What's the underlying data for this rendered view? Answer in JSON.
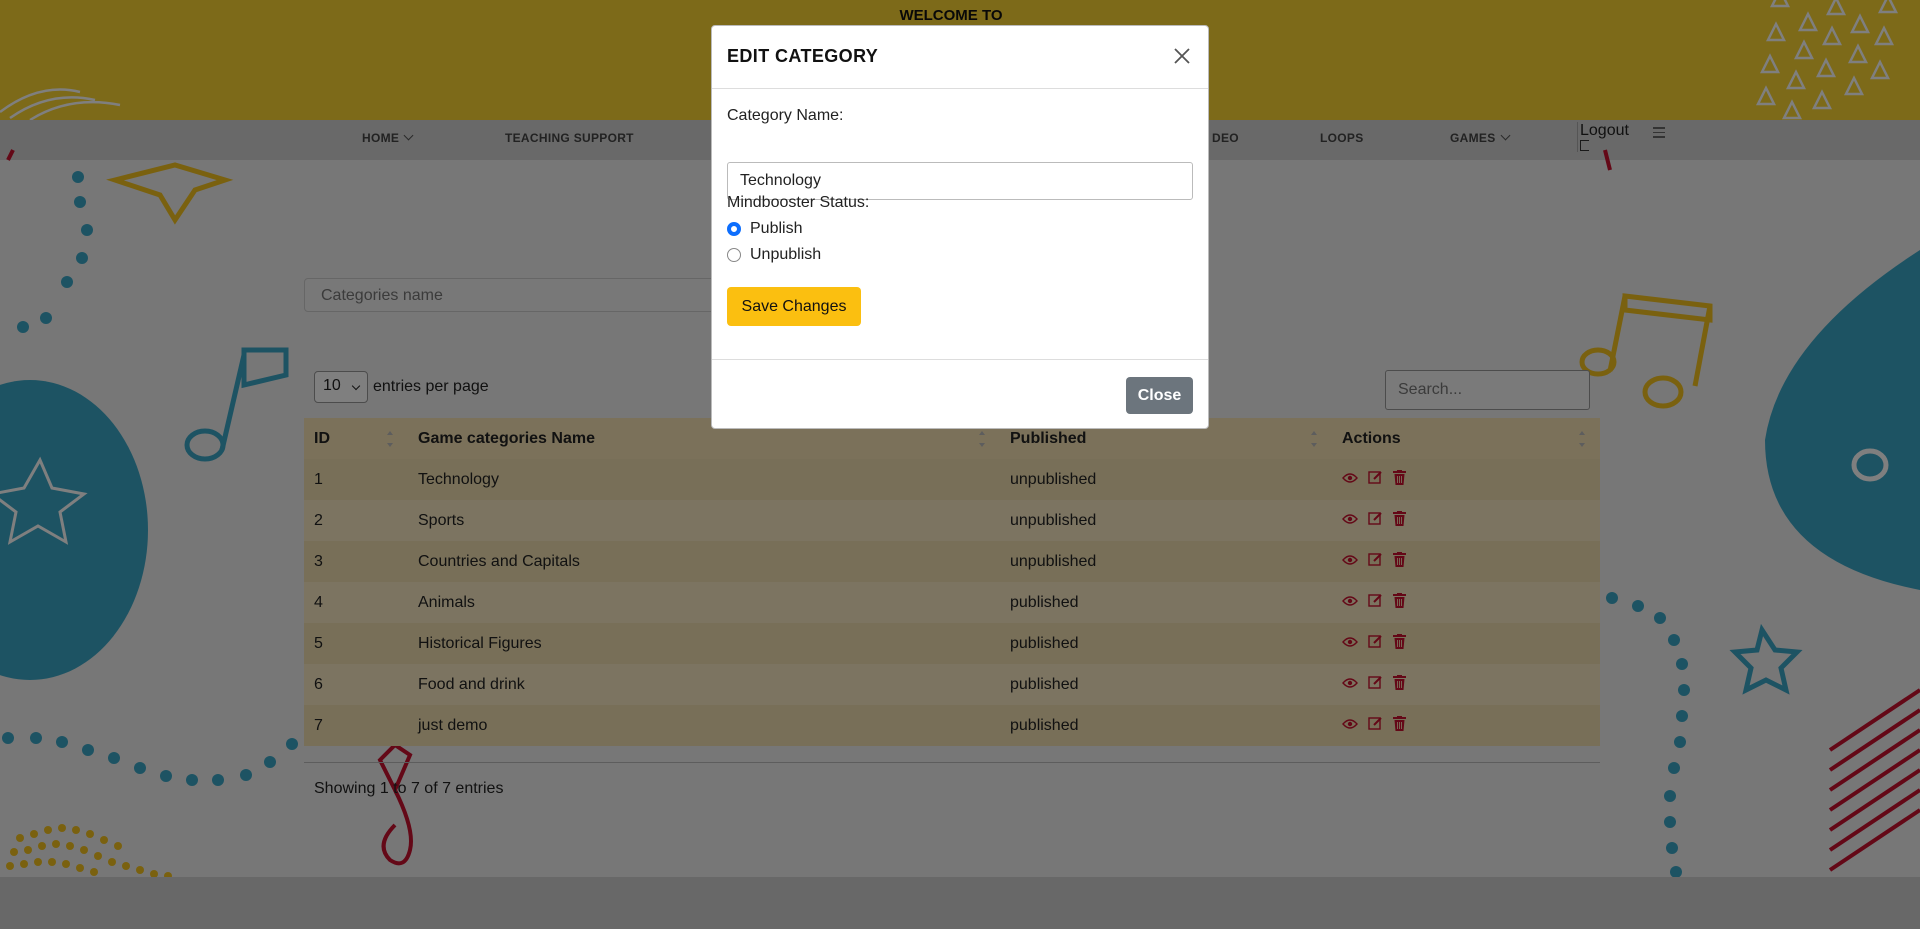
{
  "header": {
    "welcome": "WELCOME TO"
  },
  "nav": {
    "items": [
      {
        "label": "HOME",
        "dropdown": true
      },
      {
        "label": "TEACHING SUPPORT",
        "dropdown": false
      },
      {
        "label": "DEO",
        "dropdown": false
      },
      {
        "label": "LOOPS",
        "dropdown": false
      },
      {
        "label": "GAMES",
        "dropdown": true
      }
    ],
    "logout": "Logout"
  },
  "filter": {
    "placeholder": "Categories name"
  },
  "table_controls": {
    "entries_value": "10",
    "entries_label": "entries per page",
    "search_placeholder": "Search..."
  },
  "table": {
    "columns": [
      "ID",
      "Game categories Name",
      "Published",
      "Actions"
    ],
    "rows": [
      {
        "id": "1",
        "name": "Technology",
        "published": "unpublished"
      },
      {
        "id": "2",
        "name": "Sports",
        "published": "unpublished"
      },
      {
        "id": "3",
        "name": "Countries and Capitals",
        "published": "unpublished"
      },
      {
        "id": "4",
        "name": "Animals",
        "published": "published"
      },
      {
        "id": "5",
        "name": "Historical Figures",
        "published": "published"
      },
      {
        "id": "6",
        "name": "Food and drink",
        "published": "published"
      },
      {
        "id": "7",
        "name": "just demo",
        "published": "published"
      }
    ],
    "showing": "Showing 1 to 7 of 7 entries"
  },
  "modal": {
    "title": "EDIT CATEGORY",
    "name_label": "Category Name:",
    "name_value": "Technology",
    "status_label": "Mindbooster Status:",
    "options": [
      "Publish",
      "Unpublish"
    ],
    "selected": "Publish",
    "save_label": "Save Changes",
    "close_label": "Close"
  },
  "colors": {
    "header": "#fbd533",
    "save_button": "#fbbf10",
    "close_button": "#6c757d",
    "icon_red": "#c8102e",
    "table_header": "#f6e2b4"
  }
}
